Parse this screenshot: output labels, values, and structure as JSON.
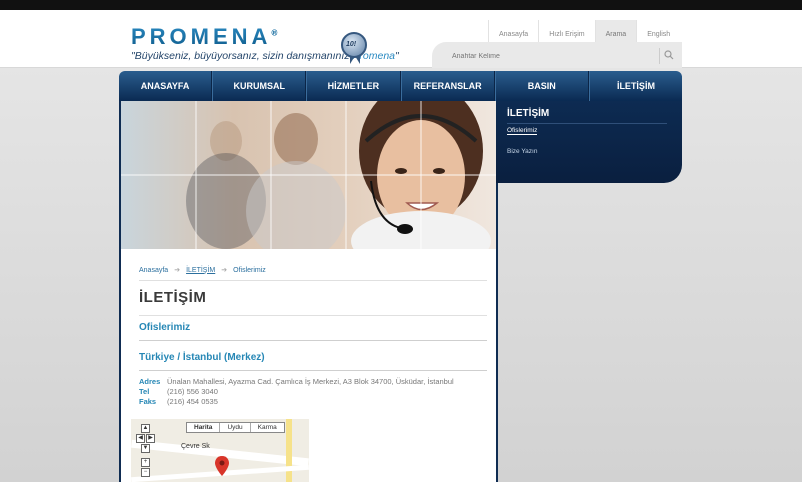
{
  "header": {
    "logo": "PROMENA",
    "logo_mark": "®",
    "slogan_main": "\"Büyükseniz, büyüyorsanız, sizin danışmanınız ",
    "slogan_brand": "Promena",
    "slogan_end": "\"",
    "seal_text": "10!",
    "top_links": [
      "Anasayfa",
      "Hızlı Erişim",
      "Arama",
      "English"
    ],
    "search_placeholder": "Anahtar Kelime"
  },
  "nav": {
    "items": [
      "ANASAYFA",
      "KURUMSAL",
      "HİZMETLER",
      "REFERANSLAR",
      "BASIN",
      "İLETİŞİM"
    ]
  },
  "sidebar": {
    "title": "İLETİŞİM",
    "items": [
      "Ofislerimiz",
      "Bize Yazın"
    ]
  },
  "content": {
    "breadcrumb": [
      "Anasayfa",
      "İLETİŞİM",
      "Ofislerimiz"
    ],
    "page_title": "İLETİŞİM",
    "section_title": "Ofislerimiz",
    "office_title": "Türkiye / İstanbul (Merkez)",
    "address": {
      "adres_label": "Adres",
      "adres_value": "Ünalan Mahallesi, Ayazma Cad. Çamlıca İş Merkezi, A3 Blok 34700, Üsküdar, İstanbul",
      "tel_label": "Tel",
      "tel_value": "(216) 556 3040",
      "faks_label": "Faks",
      "faks_value": "(216) 454 0535"
    }
  },
  "map": {
    "tabs": [
      "Harita",
      "Uydu",
      "Karma"
    ],
    "street": "Çevre Sk"
  },
  "colors": {
    "nav_dark": "#0a2a52",
    "accent_blue": "#2687b5",
    "brand_blue": "#1d6fa0"
  }
}
